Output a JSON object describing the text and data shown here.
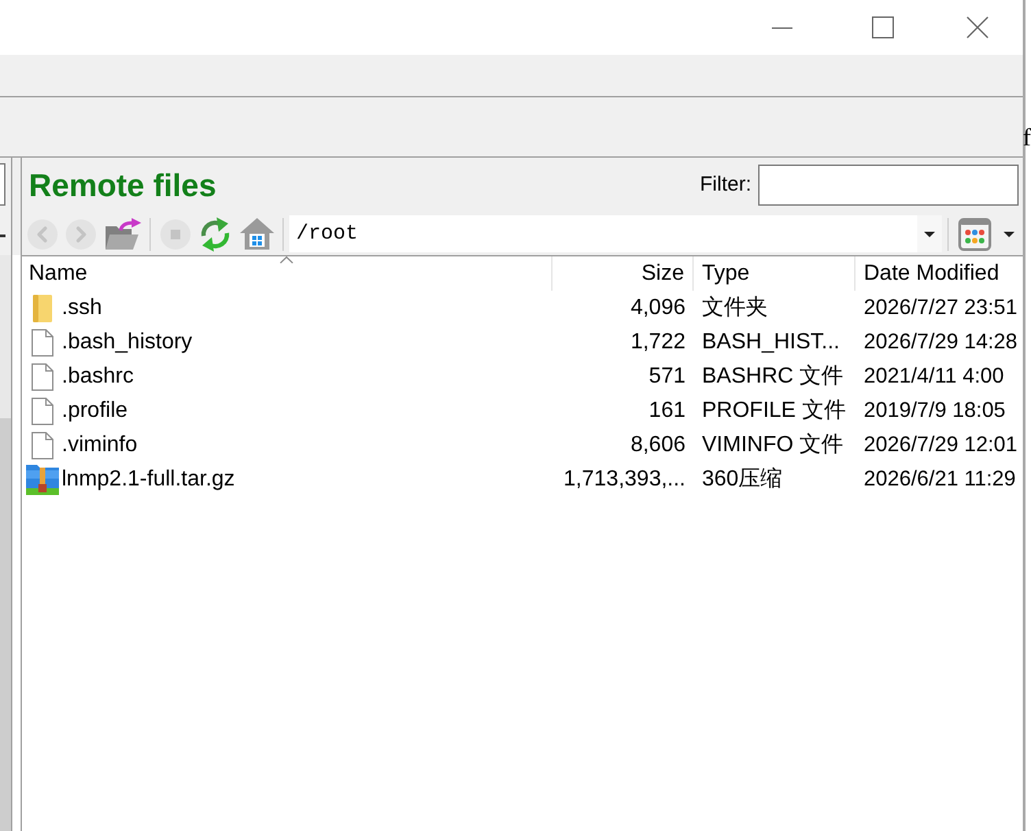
{
  "edge_text": "f",
  "remote_pane": {
    "title": "Remote files",
    "filter": {
      "label": "Filter:"
    },
    "nav_groups": [
      [
        {
          "kind": "back",
          "disabled": true
        },
        {
          "kind": "forward",
          "disabled": true
        },
        {
          "kind": "parent-folder",
          "disabled": false
        }
      ],
      [
        {
          "kind": "stop",
          "disabled": true
        },
        {
          "kind": "refresh",
          "disabled": false
        },
        {
          "kind": "home",
          "disabled": false
        }
      ]
    ],
    "path": {
      "value": "/root"
    },
    "table": {
      "columns": [
        {
          "label": "Name",
          "sorted": true
        },
        {
          "label": "Size",
          "sorted": false
        },
        {
          "label": "Type",
          "sorted": false
        },
        {
          "label": "Date Modified",
          "sorted": false
        }
      ],
      "rows": [
        {
          "kind": "folder",
          "name": ".ssh",
          "size": "4,096",
          "type": "文件夹",
          "date": "2026/7/27 23:51"
        },
        {
          "kind": "file",
          "name": ".bash_history",
          "size": "1,722",
          "type": "BASH_HIST...",
          "date": "2026/7/29 14:28"
        },
        {
          "kind": "file",
          "name": ".bashrc",
          "size": "571",
          "type": "BASHRC 文件",
          "date": "2021/4/11 4:00"
        },
        {
          "kind": "file",
          "name": ".profile",
          "size": "161",
          "type": "PROFILE 文件",
          "date": "2019/7/9 18:05"
        },
        {
          "kind": "file",
          "name": ".viminfo",
          "size": "8,606",
          "type": "VIMINFO 文件",
          "date": "2026/7/29 12:01"
        },
        {
          "kind": "archive",
          "name": "lnmp2.1-full.tar.gz",
          "size": "1,713,393,...",
          "type": "360压缩",
          "date": "2026/6/21 11:29"
        }
      ]
    }
  }
}
